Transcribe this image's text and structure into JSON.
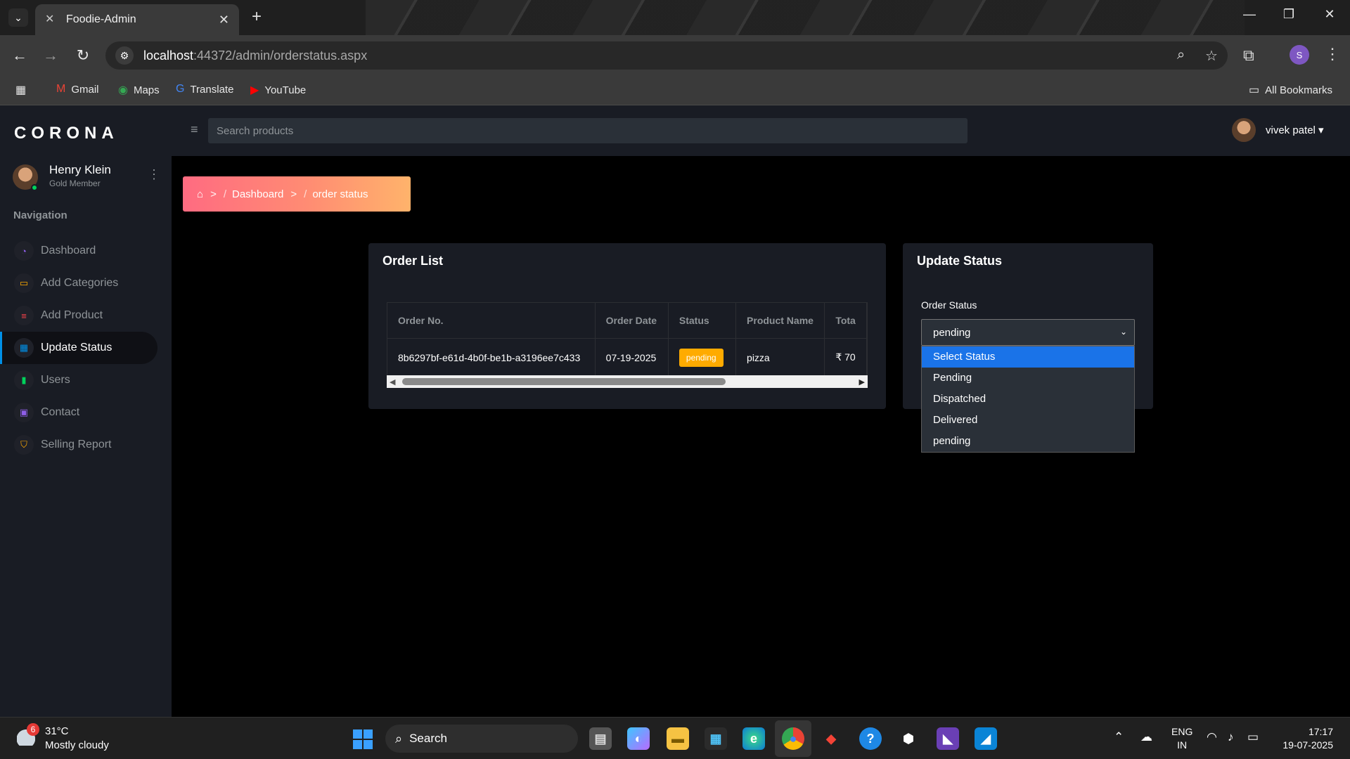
{
  "browser": {
    "tab_title": "Foodie-Admin",
    "url_host": "localhost",
    "url_path": ":44372/admin/orderstatus.aspx",
    "profile_initial": "S",
    "bookmarks": [
      "Gmail",
      "Maps",
      "Translate",
      "YouTube"
    ],
    "all_bookmarks": "All Bookmarks"
  },
  "app": {
    "brand": "CORONA",
    "user": {
      "name": "Henry Klein",
      "role": "Gold Member"
    },
    "nav_title": "Navigation",
    "nav_items": [
      {
        "label": "Dashboard",
        "icon": "speedometer-icon",
        "color": "#8f5fe8"
      },
      {
        "label": "Add Categories",
        "icon": "laptop-icon",
        "color": "#ffab00"
      },
      {
        "label": "Add Product",
        "icon": "playlist-icon",
        "color": "#fc424a"
      },
      {
        "label": "Update Status",
        "icon": "table-icon",
        "color": "#0090e7"
      },
      {
        "label": "Users",
        "icon": "chart-bar-icon",
        "color": "#00d25b"
      },
      {
        "label": "Contact",
        "icon": "contacts-icon",
        "color": "#8f5fe8"
      },
      {
        "label": "Selling Report",
        "icon": "security-icon",
        "color": "#ffab00"
      }
    ],
    "active_nav": "Update Status",
    "search_placeholder": "Search products",
    "top_user": "vivek patel"
  },
  "breadcrumb": {
    "dashboard": "Dashboard",
    "current": "order status"
  },
  "order_list": {
    "title": "Order List",
    "columns": [
      "Order No.",
      "Order Date",
      "Status",
      "Product Name",
      "Tota"
    ],
    "rows": [
      {
        "order_no": "8b6297bf-e61d-4b0f-be1b-a3196ee7c433",
        "order_date": "07-19-2025",
        "status": "pending",
        "product": "pizza",
        "total": "₹ 70"
      }
    ]
  },
  "update_status": {
    "title": "Update Status",
    "field_label": "Order Status",
    "selected": "pending",
    "options": [
      "Select Status",
      "Pending",
      "Dispatched",
      "Delivered",
      "pending"
    ],
    "highlighted_option": "Select Status"
  },
  "taskbar": {
    "weather_temp": "31°C",
    "weather_cond": "Mostly cloudy",
    "weather_badge": "6",
    "search_label": "Search",
    "lang_line1": "ENG",
    "lang_line2": "IN",
    "time": "17:17",
    "date": "19-07-2025"
  }
}
